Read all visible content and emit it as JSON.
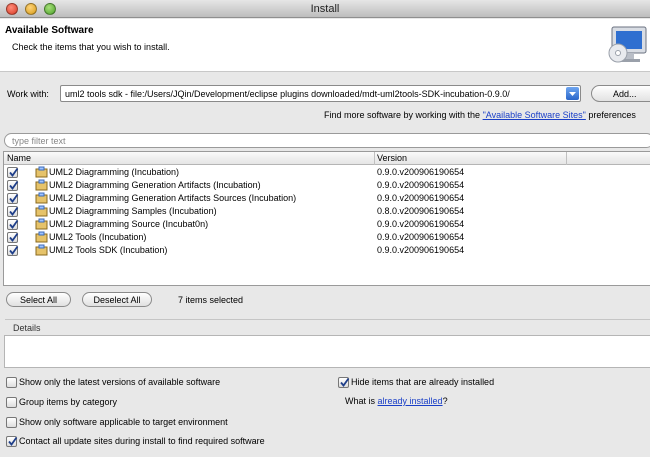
{
  "window": {
    "title": "Install"
  },
  "header": {
    "title": "Available Software",
    "description": "Check the items that you wish to install.",
    "icon": "monitor-cd-icon"
  },
  "work_with": {
    "label": "Work with:",
    "value": "uml2 tools sdk - file:/Users/JQin/Development/eclipse plugins downloaded/mdt-uml2tools-SDK-incubation-0.9.0/",
    "add_label": "Add..."
  },
  "find_more": {
    "prefix": "Find more software by working with the ",
    "link": "\"Available Software Sites\"",
    "suffix": " preferences"
  },
  "filter": {
    "placeholder": "type filter text"
  },
  "table": {
    "columns": [
      "Name",
      "Version"
    ],
    "rows": [
      {
        "name": "UML2 Diagramming (Incubation)",
        "version": "0.9.0.v200906190654",
        "checked": true
      },
      {
        "name": "UML2 Diagramming Generation Artifacts (Incubation)",
        "version": "0.9.0.v200906190654",
        "checked": true
      },
      {
        "name": "UML2 Diagramming Generation Artifacts Sources (Incubation)",
        "version": "0.9.0.v200906190654",
        "checked": true
      },
      {
        "name": "UML2 Diagramming Samples (Incubation)",
        "version": "0.8.0.v200906190654",
        "checked": true
      },
      {
        "name": "UML2 Diagramming Source (Incubat0n)",
        "version": "0.9.0.v200906190654",
        "checked": true
      },
      {
        "name": "UML2 Tools (Incubation)",
        "version": "0.9.0.v200906190654",
        "checked": true
      },
      {
        "name": "UML2 Tools SDK (Incubation)",
        "version": "0.9.0.v200906190654",
        "checked": true
      }
    ]
  },
  "actions": {
    "select_all": "Select All",
    "deselect_all": "Deselect All",
    "selected_count": "7 items selected"
  },
  "details": {
    "label": "Details"
  },
  "options": {
    "latest_versions": {
      "label": "Show only the latest versions of available software",
      "checked": false
    },
    "group_by_category": {
      "label": "Group items by category",
      "checked": false
    },
    "target_env": {
      "label": "Show only software applicable to target environment",
      "checked": false
    },
    "contact_sites": {
      "label": "Contact all update sites during install to find required software",
      "checked": true
    },
    "hide_installed": {
      "label": "Hide items that are already installed",
      "checked": true
    },
    "what_is": {
      "prefix": "What is ",
      "link": "already installed",
      "suffix": "?"
    }
  }
}
